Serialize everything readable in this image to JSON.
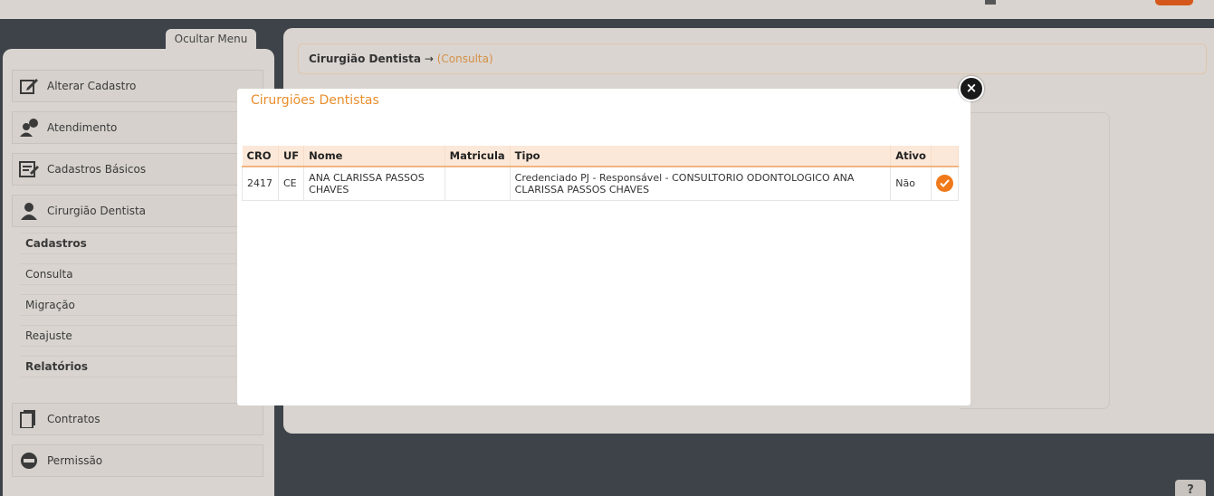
{
  "sidebar": {
    "hide_menu": "Ocultar Menu",
    "items": [
      {
        "label": "Alterar Cadastro",
        "icon": "edit-icon"
      },
      {
        "label": "Atendimento",
        "icon": "users-chat-icon"
      },
      {
        "label": "Cadastros Básicos",
        "icon": "document-edit-icon"
      },
      {
        "label": "Cirurgião Dentista",
        "icon": "user-icon"
      }
    ],
    "subitems": [
      {
        "label": "Cadastros",
        "bold": true
      },
      {
        "label": "Consulta",
        "bold": false
      },
      {
        "label": "Migração",
        "bold": false
      },
      {
        "label": "Reajuste",
        "bold": false
      },
      {
        "label": "Relatórios",
        "bold": true
      }
    ],
    "items2": [
      {
        "label": "Contratos",
        "icon": "contract-icon"
      },
      {
        "label": "Permissão",
        "icon": "no-entry-icon"
      }
    ]
  },
  "breadcrumb": {
    "main": "Cirurgião Dentista",
    "arrow": "→",
    "sub": "(Consulta)"
  },
  "help": "?",
  "modal": {
    "title": "Cirurgiões Dentistas",
    "close": "×",
    "table": {
      "headers": [
        "CRO",
        "UF",
        "Nome",
        "Matricula",
        "Tipo",
        "Ativo",
        ""
      ],
      "rows": [
        {
          "cro": "2417",
          "uf": "CE",
          "nome": "ANA CLARISSA PASSOS CHAVES",
          "matricula": "",
          "tipo": "Credenciado PJ - Responsável - CONSULTORIO ODONTOLOGICO ANA CLARISSA PASSOS CHAVES",
          "ativo": "Não"
        }
      ]
    }
  },
  "colors": {
    "accent": "#f07a1b",
    "title": "#ea8d2c",
    "overlay": "#3d4349"
  }
}
